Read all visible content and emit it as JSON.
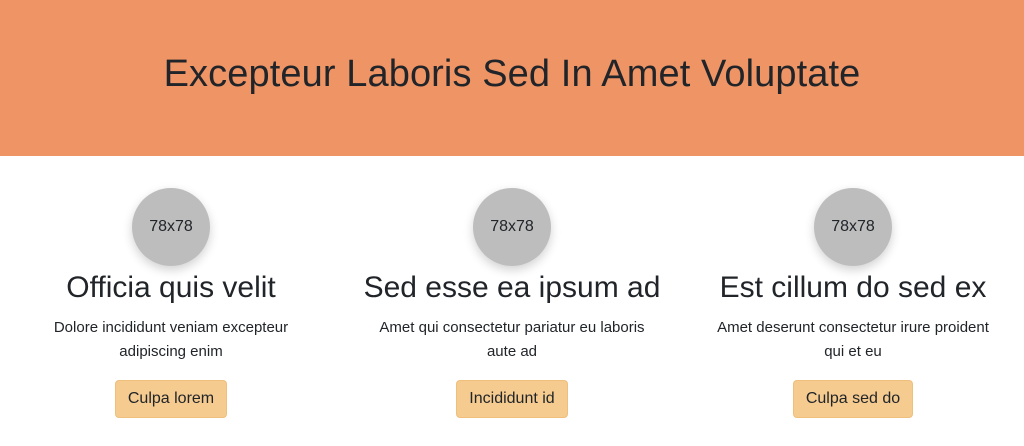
{
  "hero": {
    "title": "Excepteur Laboris Sed In Amet Voluptate"
  },
  "colors": {
    "hero_background": "#ef9465",
    "button_background": "#f5cb8f",
    "avatar_background": "#bdbdbd"
  },
  "cards": [
    {
      "avatar_label": "78x78",
      "title": "Officia quis velit",
      "text": "Dolore incididunt veniam excepteur adipiscing enim",
      "button": "Culpa lorem"
    },
    {
      "avatar_label": "78x78",
      "title": "Sed esse ea ipsum ad",
      "text": "Amet qui consectetur pariatur eu laboris aute ad",
      "button": "Incididunt id"
    },
    {
      "avatar_label": "78x78",
      "title": "Est cillum do sed ex",
      "text": "Amet deserunt consectetur irure proident qui et eu",
      "button": "Culpa sed do"
    }
  ]
}
